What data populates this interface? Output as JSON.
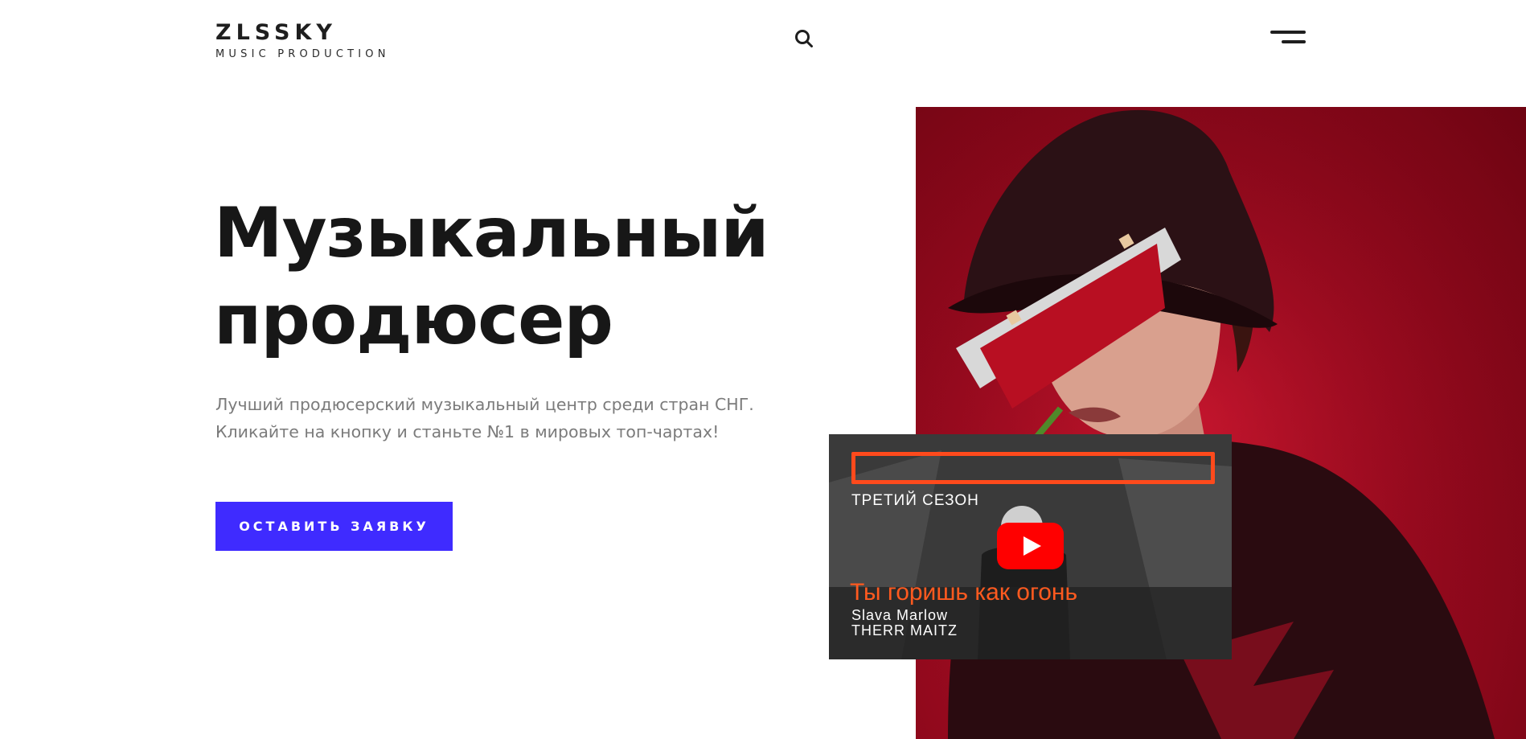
{
  "header": {
    "logo_title": "ZLSSKY",
    "logo_subtitle": "MUSIC PRODUCTION",
    "search_icon": "search-icon",
    "menu_icon": "hamburger-menu-icon"
  },
  "hero": {
    "title_line1": "Музыкальный",
    "title_line2": "продюсер",
    "description_line1": "Лучший продюсерский музыкальный центр среди стран СНГ.",
    "description_line2": "Кликайте на кнопку и станьте №1 в мировых топ-чартах!",
    "cta_label": "ОСТАВИТЬ ЗАЯВКУ"
  },
  "video": {
    "season": "ТРЕТИЙ СЕЗОН",
    "song": "Ты горишь как огонь",
    "artist_1": "Slava Marlow",
    "artist_2": "THERR MAITZ",
    "play_icon": "youtube-play-icon"
  },
  "colors": {
    "accent": "#3f2bff",
    "photo_background": "#a30b22",
    "video_accent": "#ff4a1c",
    "play_button": "#ff0000"
  }
}
